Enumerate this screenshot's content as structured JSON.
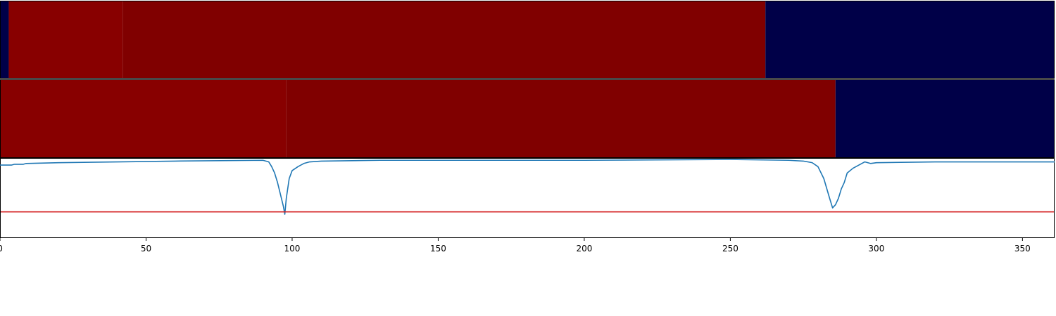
{
  "chart_data": {
    "type": "heatmap",
    "xlim": [
      0,
      361
    ],
    "x_ticks": [
      0,
      50,
      100,
      150,
      200,
      250,
      300,
      350
    ],
    "x_tick_labels": [
      "0",
      "50",
      "100",
      "150",
      "200",
      "250",
      "300",
      "350"
    ],
    "grid": false,
    "segment_rows": [
      {
        "segments": [
          {
            "start": 0,
            "end": 3,
            "color": "#000048"
          },
          {
            "start": 3,
            "end": 42,
            "color": "#880000"
          },
          {
            "start": 42,
            "end": 262,
            "color": "#800000"
          },
          {
            "start": 262,
            "end": 361,
            "color": "#000048"
          }
        ]
      },
      {
        "segments": [
          {
            "start": 0,
            "end": 98,
            "color": "#880000"
          },
          {
            "start": 98,
            "end": 286,
            "color": "#800000"
          },
          {
            "start": 286,
            "end": 361,
            "color": "#000048"
          }
        ]
      }
    ],
    "series": [
      {
        "type": "line",
        "color": "#1f77b4",
        "ylim": [
          0,
          1
        ],
        "points": [
          [
            0,
            0.92
          ],
          [
            4,
            0.92
          ],
          [
            5,
            0.93
          ],
          [
            8,
            0.93
          ],
          [
            9,
            0.94
          ],
          [
            20,
            0.95
          ],
          [
            40,
            0.96
          ],
          [
            60,
            0.97
          ],
          [
            90,
            0.98
          ],
          [
            92,
            0.96
          ],
          [
            93,
            0.9
          ],
          [
            94,
            0.82
          ],
          [
            95,
            0.7
          ],
          [
            96,
            0.55
          ],
          [
            97,
            0.4
          ],
          [
            97.5,
            0.3
          ],
          [
            98,
            0.5
          ],
          [
            99,
            0.75
          ],
          [
            100,
            0.85
          ],
          [
            102,
            0.9
          ],
          [
            104,
            0.94
          ],
          [
            106,
            0.96
          ],
          [
            110,
            0.97
          ],
          [
            130,
            0.98
          ],
          [
            200,
            0.98
          ],
          [
            250,
            0.99
          ],
          [
            270,
            0.98
          ],
          [
            275,
            0.97
          ],
          [
            278,
            0.95
          ],
          [
            280,
            0.9
          ],
          [
            282,
            0.75
          ],
          [
            284,
            0.5
          ],
          [
            285,
            0.38
          ],
          [
            286,
            0.42
          ],
          [
            287,
            0.5
          ],
          [
            288,
            0.62
          ],
          [
            289,
            0.7
          ],
          [
            290,
            0.82
          ],
          [
            292,
            0.88
          ],
          [
            294,
            0.92
          ],
          [
            296,
            0.96
          ],
          [
            298,
            0.94
          ],
          [
            300,
            0.95
          ],
          [
            320,
            0.96
          ],
          [
            361,
            0.96
          ]
        ]
      },
      {
        "type": "hline",
        "color": "#d62728",
        "y": 0.33
      }
    ]
  }
}
